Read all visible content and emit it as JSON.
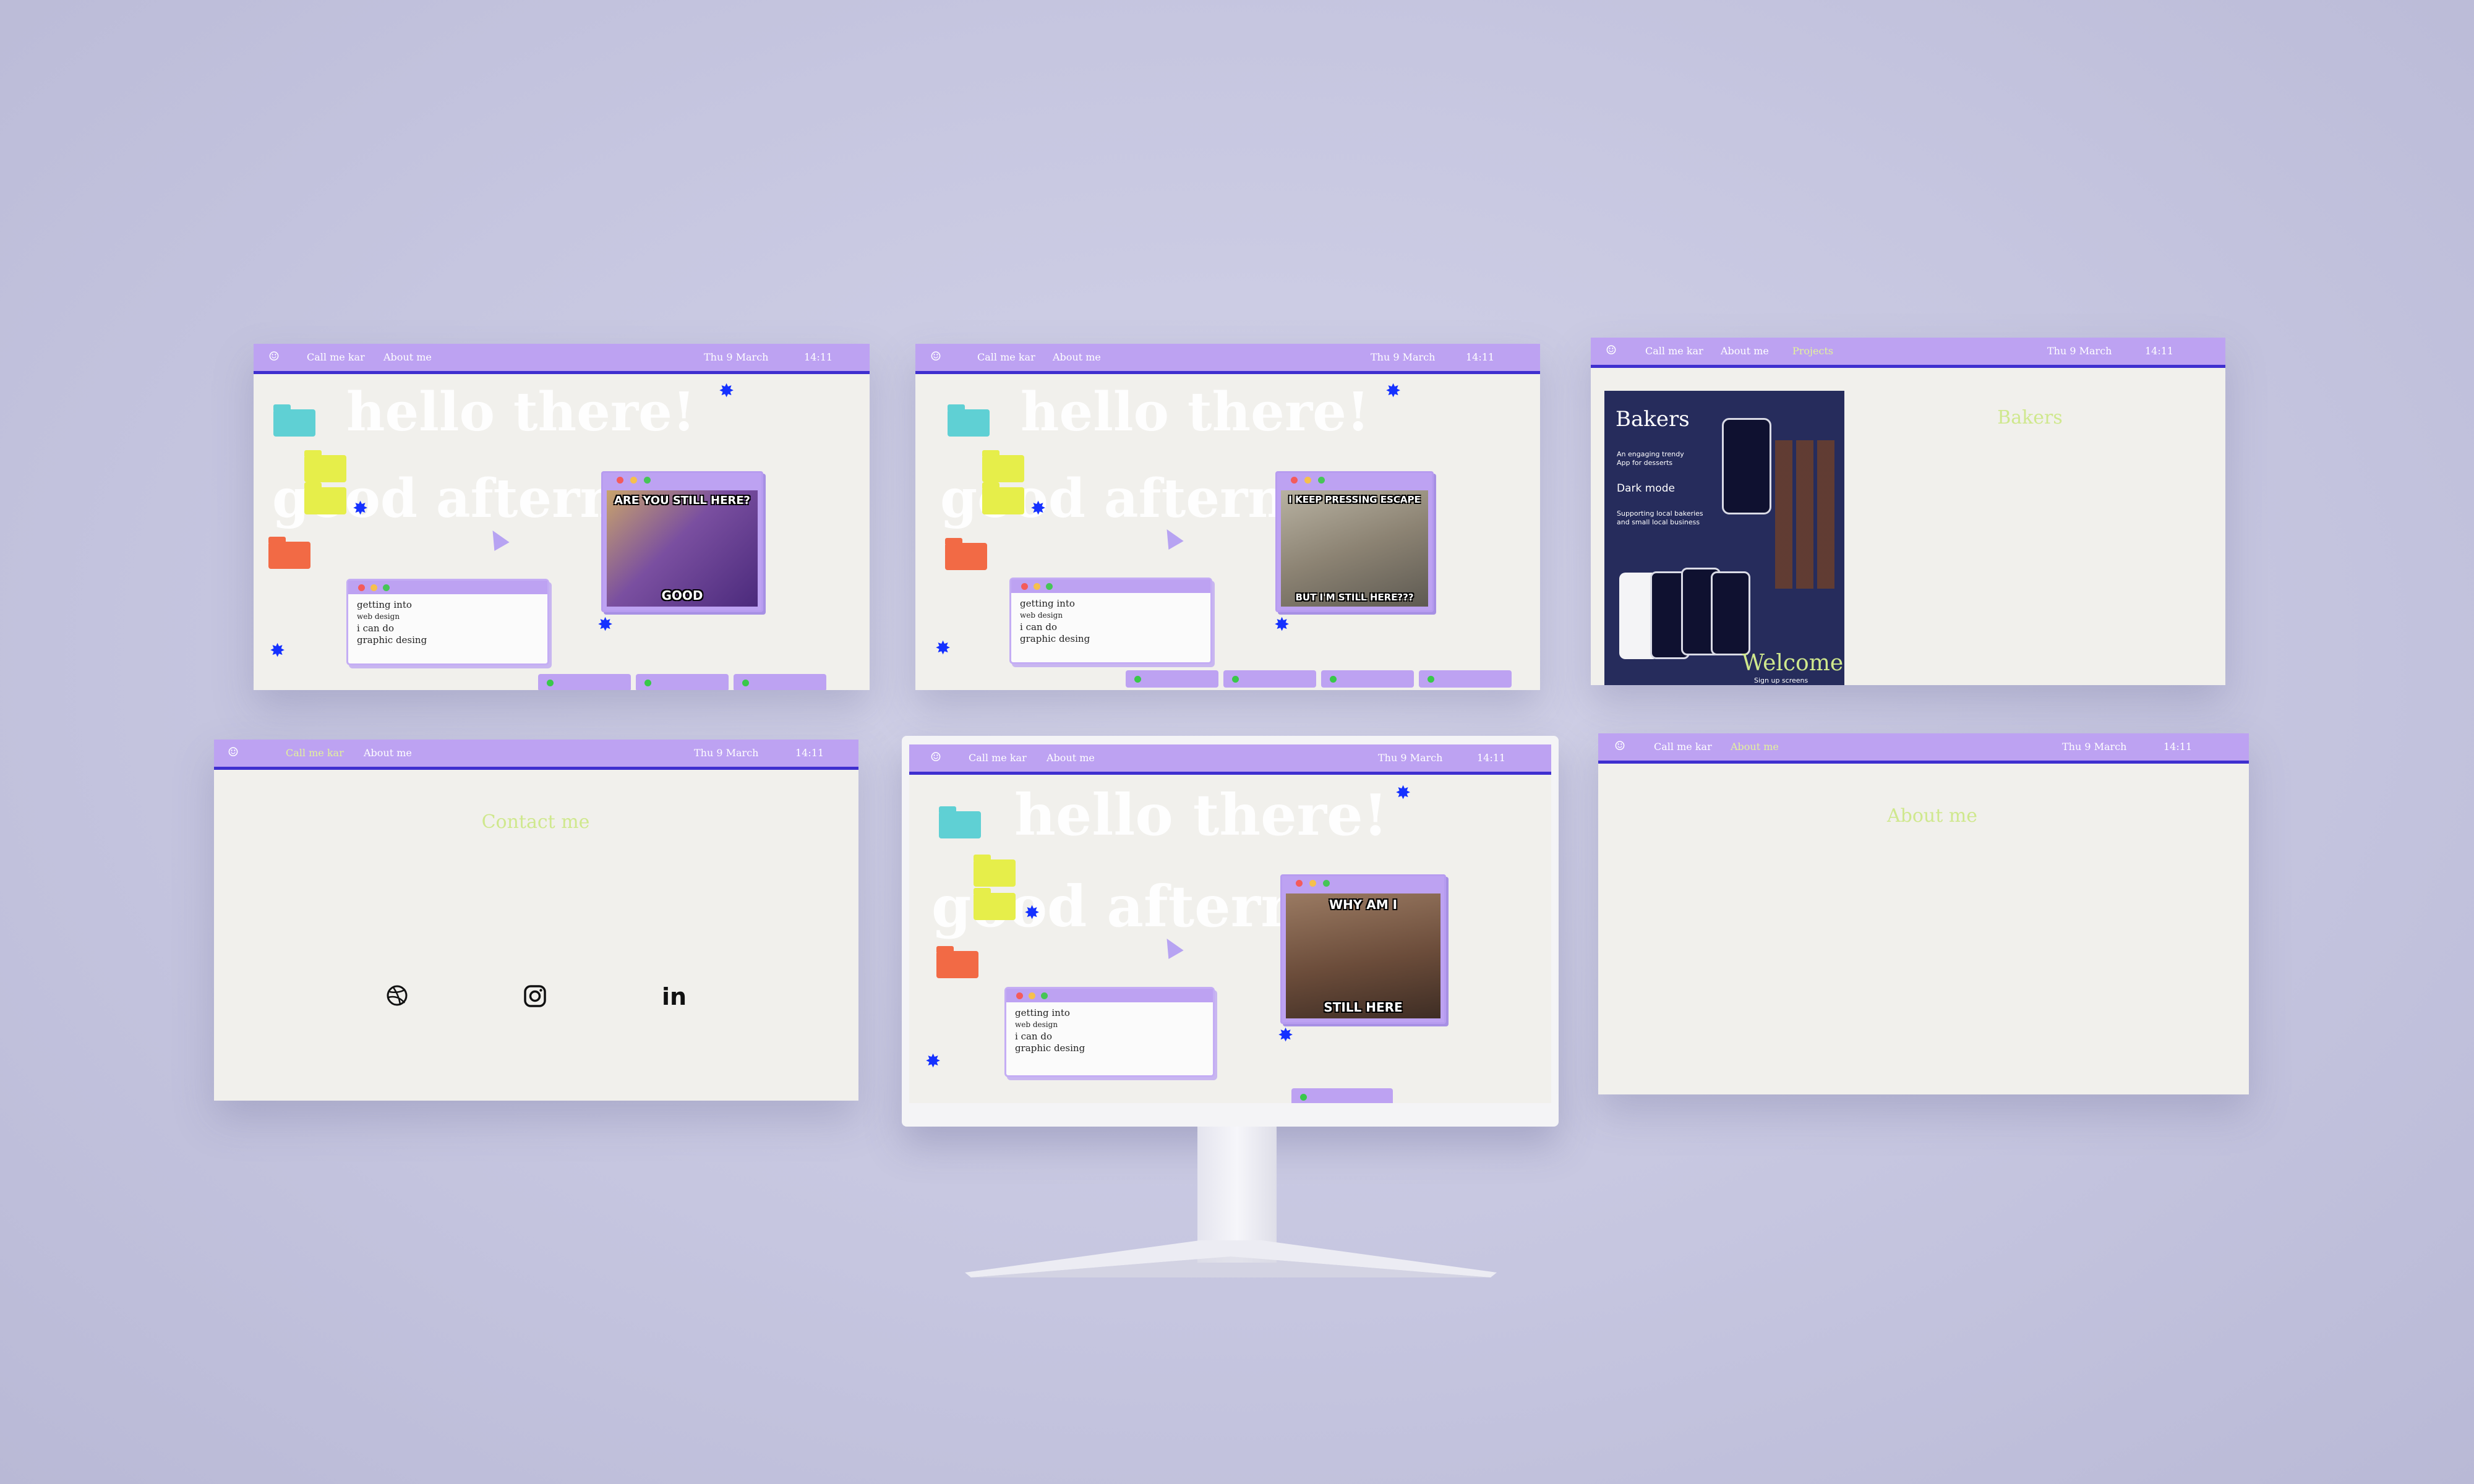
{
  "nav": {
    "smile": "☺",
    "brand": "Call me kar",
    "about": "About me",
    "projects": "Projects",
    "date": "Thu 9 March",
    "time": "14:11"
  },
  "hero": {
    "line1": "hello there!",
    "line2": "good aftern"
  },
  "note": {
    "line1": "getting into",
    "line2": "web design",
    "line3": "i  can do",
    "line4": "graphic desing"
  },
  "memes": {
    "meme1_top": "ARE YOU STILL HERE?",
    "meme1_bottom": "GOOD",
    "meme2_top": "I KEEP PRESSING ESCAPE",
    "meme2_bottom": "BUT I'M STILL HERE???",
    "meme3_top": "WHY AM I",
    "meme3_bottom": "STILL HERE"
  },
  "projects_page": {
    "card_title": "Bakers",
    "card_sub1": "An engaging trendy",
    "card_sub2": "App for desserts",
    "card_mode": "Dark mode",
    "card_support1": "Supporting local bakeries",
    "card_support2": "and small local business",
    "card_welcome": "Welcome",
    "card_signup": "Sign up screens",
    "heading": "Bakers"
  },
  "contact_page": {
    "heading": "Contact me"
  },
  "about_page": {
    "heading": "About me"
  },
  "social": {
    "dribbble": "dribbble-icon",
    "instagram": "instagram-icon",
    "linkedin": "in"
  },
  "colors": {
    "navbar": "#bda2f2",
    "navbar_line": "#3f2fcf",
    "accent_green": "#cfe88d",
    "star_blue": "#1531ff",
    "folder_teal": "#5fd0d4",
    "folder_yellow": "#e6ee4a",
    "folder_orange": "#f26a45",
    "projects_card": "#262c5c"
  }
}
